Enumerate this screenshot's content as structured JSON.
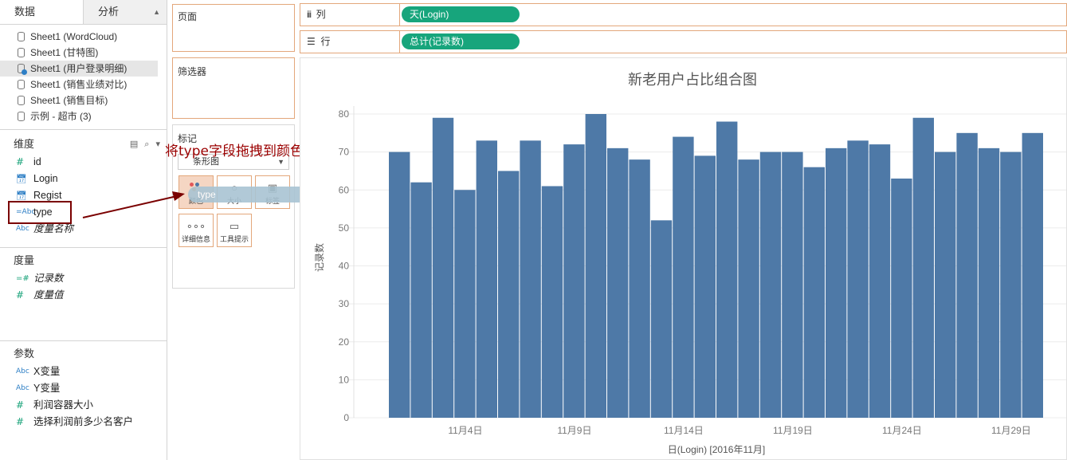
{
  "left_pane": {
    "tabs": [
      {
        "label": "数据"
      },
      {
        "label": "分析"
      }
    ],
    "tab_arrows": "⬘",
    "datasources": [
      {
        "label": "Sheet1 (WordCloud)"
      },
      {
        "label": "Sheet1 (甘特图)"
      },
      {
        "label": "Sheet1 (用户登录明细)"
      },
      {
        "label": "Sheet1 (销售业绩对比)"
      },
      {
        "label": "Sheet1 (销售目标)"
      },
      {
        "label": "示例 - 超市 (3)"
      }
    ],
    "dimensions": {
      "header": "维度",
      "fields": [
        {
          "icon": "#",
          "label": "id"
        },
        {
          "icon": "date",
          "label": "Login"
        },
        {
          "icon": "date",
          "label": "Regist"
        },
        {
          "icon": "=Abc",
          "label": "type"
        },
        {
          "icon": "Abc",
          "label": "度量名称"
        }
      ]
    },
    "measures": {
      "header": "度量",
      "fields": [
        {
          "icon": "=#",
          "label": "记录数"
        },
        {
          "icon": "#",
          "label": "度量值"
        }
      ]
    },
    "parameters": {
      "header": "参数",
      "fields": [
        {
          "icon": "Abc",
          "label": "X变量"
        },
        {
          "icon": "Abc",
          "label": "Y变量"
        },
        {
          "icon": "#",
          "label": "利润容器大小"
        },
        {
          "icon": "#",
          "label": "选择利润前多少名客户"
        }
      ]
    }
  },
  "cards": {
    "pages": "页面",
    "filters": "筛选器",
    "marks": {
      "title": "标记",
      "mark_type": "条形图",
      "buttons": [
        {
          "label": "颜色",
          "icon": "color-dots-icon"
        },
        {
          "label": "大小",
          "icon": "size-icon"
        },
        {
          "label": "标签",
          "icon": "label-icon"
        },
        {
          "label": "详细信息",
          "icon": "detail-icon"
        },
        {
          "label": "工具提示",
          "icon": "tooltip-icon"
        }
      ]
    }
  },
  "drag_pill": {
    "label": "type"
  },
  "annotation": {
    "text": "将type字段拖拽到颜色中",
    "color": "#9b0000"
  },
  "shelves": {
    "columns": {
      "label": "列",
      "pill": "天(Login)"
    },
    "rows": {
      "label": "行",
      "pill": "总计(记录数)"
    },
    "pill_color": "#17a57c"
  },
  "chart_data": {
    "type": "bar",
    "title": "新老用户占比组合图",
    "xlabel": "日(Login) [2016年11月]",
    "ylabel": "记录数",
    "ylim": [
      0,
      80
    ],
    "yticks": [
      0,
      10,
      20,
      30,
      40,
      50,
      60,
      70,
      80
    ],
    "x_tick_labels": [
      {
        "day": 4,
        "label": "11月4日"
      },
      {
        "day": 9,
        "label": "11月9日"
      },
      {
        "day": 14,
        "label": "11月14日"
      },
      {
        "day": 19,
        "label": "11月19日"
      },
      {
        "day": 24,
        "label": "11月24日"
      },
      {
        "day": 29,
        "label": "11月29日"
      }
    ],
    "categories": [
      1,
      2,
      3,
      4,
      5,
      6,
      7,
      8,
      9,
      10,
      11,
      12,
      13,
      14,
      15,
      16,
      17,
      18,
      19,
      20,
      21,
      22,
      23,
      24,
      25,
      26,
      27,
      28,
      29,
      30
    ],
    "values": [
      70,
      62,
      79,
      60,
      73,
      65,
      73,
      61,
      72,
      80,
      71,
      68,
      52,
      74,
      69,
      78,
      68,
      70,
      70,
      66,
      71,
      73,
      72,
      63,
      79,
      70,
      75,
      71,
      70,
      75
    ],
    "bar_color": "#4e79a7",
    "grid": true
  }
}
